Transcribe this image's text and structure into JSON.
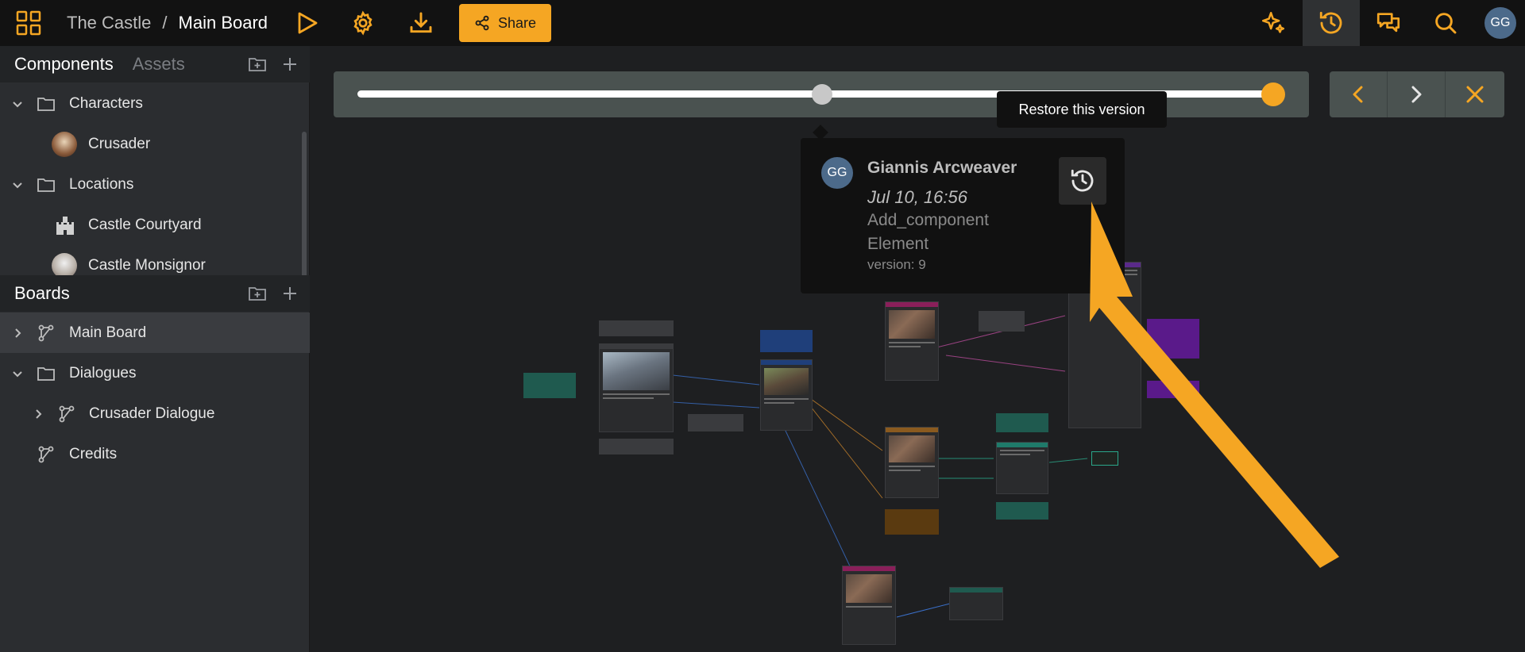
{
  "topbar": {
    "breadcrumb_project": "The Castle",
    "breadcrumb_separator": "/",
    "breadcrumb_board": "Main Board",
    "share_label": "Share",
    "user_initials": "GG",
    "accent_color": "#f5a623"
  },
  "sidebar": {
    "components_tab": "Components",
    "assets_tab": "Assets",
    "components": [
      {
        "label": "Characters",
        "type": "folder",
        "expanded": true
      },
      {
        "label": "Crusader",
        "type": "component"
      },
      {
        "label": "Locations",
        "type": "folder",
        "expanded": true
      },
      {
        "label": "Castle Courtyard",
        "type": "component"
      },
      {
        "label": "Castle Monsignor",
        "type": "component"
      }
    ],
    "boards_title": "Boards",
    "boards": [
      {
        "label": "Main Board",
        "type": "board",
        "selected": true
      },
      {
        "label": "Dialogues",
        "type": "folder",
        "expanded": true
      },
      {
        "label": "Crusader Dialogue",
        "type": "board"
      },
      {
        "label": "Credits",
        "type": "board"
      }
    ]
  },
  "history": {
    "tooltip": "Restore this version",
    "version_author_initials": "GG",
    "version_author": "Giannis Arcweaver",
    "version_date": "Jul 10, 16:56",
    "version_action": "Add_component",
    "version_target": "Element",
    "version_label": "version: 9"
  }
}
